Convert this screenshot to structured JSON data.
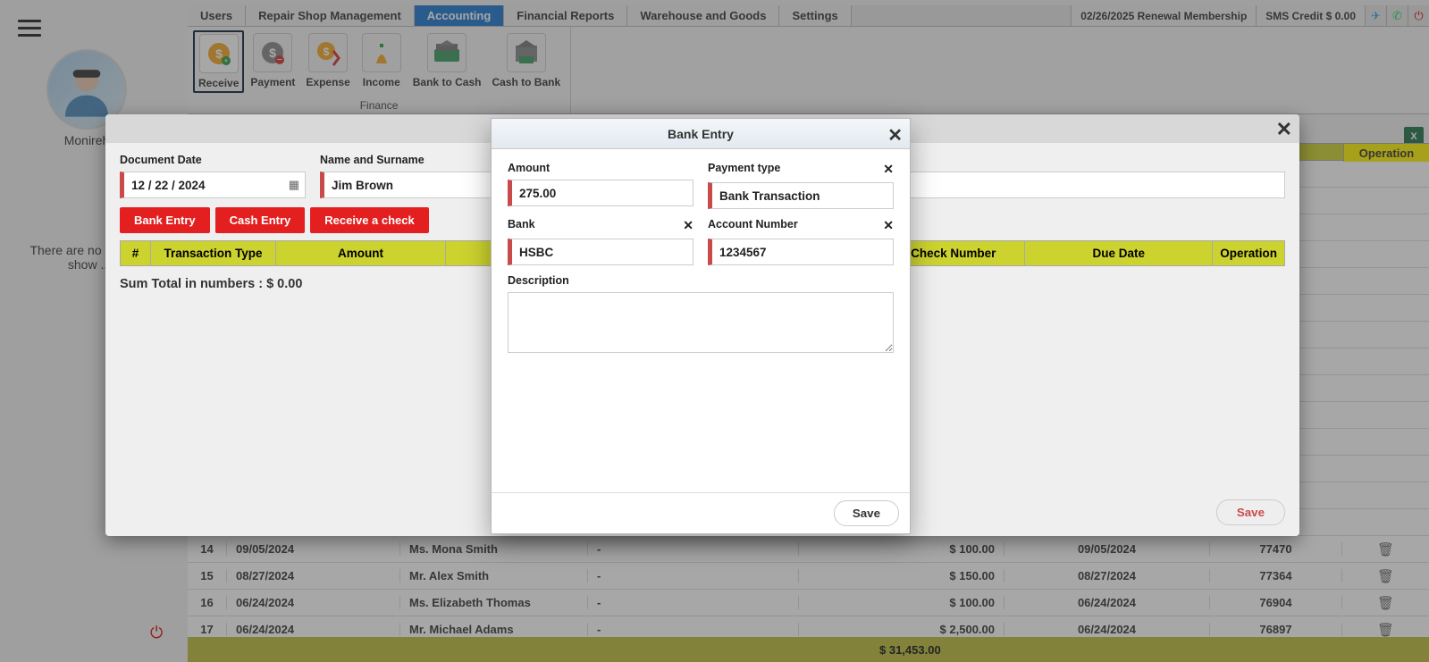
{
  "user": {
    "name": "Monireh"
  },
  "no_items": "There are no items to show ...",
  "tabs": {
    "users": "Users",
    "repair": "Repair Shop Management",
    "accounting": "Accounting",
    "financial": "Financial Reports",
    "warehouse": "Warehouse and Goods",
    "settings": "Settings"
  },
  "topbar": {
    "renewal": "02/26/2025 Renewal Membership",
    "sms": "SMS Credit $ 0.00"
  },
  "ribbon": {
    "receive": "Receive",
    "payment": "Payment",
    "expense": "Expense",
    "income": "Income",
    "bank_to_cash": "Bank to Cash",
    "cash_to_bank": "Cash to Bank",
    "group": "Finance"
  },
  "bg": {
    "operation": "Operation",
    "excel": "X",
    "total": "$ 31,453.00",
    "rows": [
      {
        "idx": "14",
        "date": "09/05/2024",
        "name": "Ms. Mona Smith",
        "dash": "-",
        "amt": "$ 100.00",
        "date2": "09/05/2024",
        "num": "77470"
      },
      {
        "idx": "15",
        "date": "08/27/2024",
        "name": "Mr. Alex Smith",
        "dash": "-",
        "amt": "$ 150.00",
        "date2": "08/27/2024",
        "num": "77364"
      },
      {
        "idx": "16",
        "date": "06/24/2024",
        "name": "Ms. Elizabeth Thomas",
        "dash": "-",
        "amt": "$ 100.00",
        "date2": "06/24/2024",
        "num": "76904"
      },
      {
        "idx": "17",
        "date": "06/24/2024",
        "name": "Mr. Michael Adams",
        "dash": "-",
        "amt": "$ 2,500.00",
        "date2": "06/24/2024",
        "num": "76897"
      }
    ]
  },
  "outer": {
    "doc_date_label": "Document Date",
    "doc_date": "12 / 22 / 2024",
    "name_label": "Name and Surname",
    "name": "Jim Brown",
    "btn_bank": "Bank Entry",
    "btn_cash": "Cash Entry",
    "btn_check": "Receive a check",
    "th_num": "#",
    "th_type": "Transaction Type",
    "th_amount": "Amount",
    "th_checknum": "Check Number",
    "th_due": "Due Date",
    "th_op": "Operation",
    "sum": "Sum Total in numbers : $ 0.00",
    "save": "Save"
  },
  "inner": {
    "title": "Bank Entry",
    "amount_label": "Amount",
    "amount": "275.00",
    "ptype_label": "Payment type",
    "ptype": "Bank Transaction",
    "bank_label": "Bank",
    "bank": "HSBC",
    "acct_label": "Account Number",
    "acct": "1234567",
    "desc_label": "Description",
    "save": "Save",
    "x": "✕"
  }
}
